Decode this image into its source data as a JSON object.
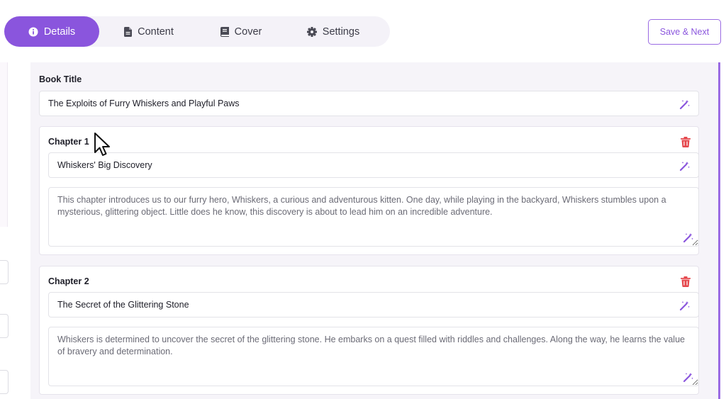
{
  "tabs": [
    {
      "label": "Details",
      "icon": "info-icon",
      "active": true
    },
    {
      "label": "Content",
      "icon": "document-icon",
      "active": false
    },
    {
      "label": "Cover",
      "icon": "book-icon",
      "active": false
    },
    {
      "label": "Settings",
      "icon": "gear-icon",
      "active": false
    }
  ],
  "save_button": "Save & Next",
  "book": {
    "title_label": "Book Title",
    "title_value": "The Exploits of Furry Whiskers and Playful Paws"
  },
  "chapters": [
    {
      "label": "Chapter 1",
      "title": "Whiskers' Big Discovery",
      "summary": "This chapter introduces us to our furry hero, Whiskers, a curious and adventurous kitten. One day, while playing in the backyard, Whiskers stumbles upon a mysterious, glittering object. Little does he know, this discovery is about to lead him on an incredible adventure."
    },
    {
      "label": "Chapter 2",
      "title": "The Secret of the Glittering Stone",
      "summary": "Whiskers is determined to uncover the secret of the glittering stone. He embarks on a quest filled with riddles and challenges. Along the way, he learns the value of bravery and determination."
    }
  ],
  "colors": {
    "accent": "#8a55dd",
    "danger": "#e5484d"
  }
}
